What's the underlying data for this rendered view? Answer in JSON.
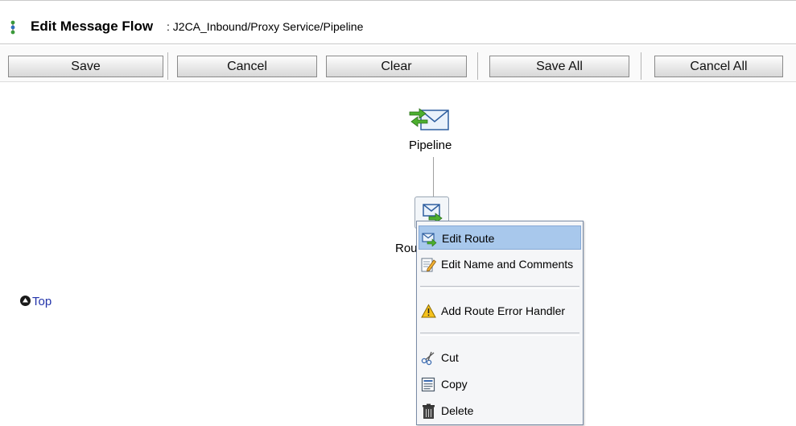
{
  "header": {
    "title": "Edit Message Flow",
    "path": ": J2CA_Inbound/Proxy Service/Pipeline",
    "icon": "flow-icon"
  },
  "toolbar": {
    "save_label": "Save",
    "cancel_label": "Cancel",
    "clear_label": "Clear",
    "save_all_label": "Save All",
    "cancel_all_label": "Cancel All"
  },
  "canvas": {
    "pipeline_label": "Pipeline",
    "route_label": "Rou",
    "top_link": "Top"
  },
  "context_menu": {
    "items": [
      {
        "label": "Edit Route",
        "icon": "edit-route-icon"
      },
      {
        "label": "Edit Name and Comments",
        "icon": "pencil-note-icon"
      },
      {
        "label": "Add Route Error Handler",
        "icon": "warning-icon"
      },
      {
        "label": "Cut",
        "icon": "scissors-icon"
      },
      {
        "label": "Copy",
        "icon": "copy-icon"
      },
      {
        "label": "Delete",
        "icon": "trash-icon"
      }
    ]
  },
  "colors": {
    "menu_highlight": "#a8c8ec",
    "link": "#2233aa"
  }
}
